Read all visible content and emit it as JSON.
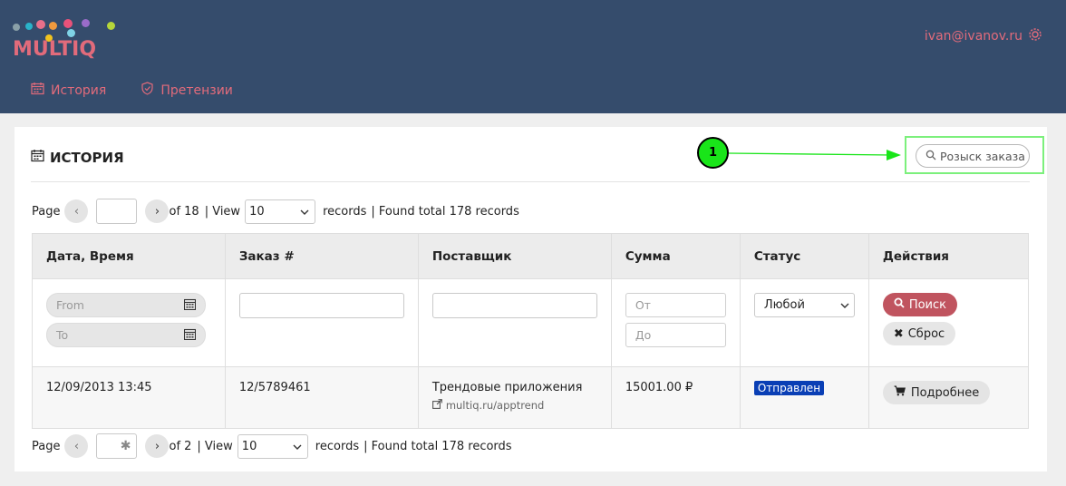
{
  "brand": {
    "logo_text": "MULTIQ"
  },
  "header": {
    "user_email": "ivan@ivanov.ru"
  },
  "nav": {
    "items": [
      {
        "label": "История",
        "icon": "calendar-icon"
      },
      {
        "label": "Претензии",
        "icon": "shield-icon"
      }
    ]
  },
  "page": {
    "title": "ИСТОРИЯ",
    "search_placeholder": "Розыск заказа",
    "annotation_number": "1"
  },
  "pager_top": {
    "page_label": "Page",
    "page_value": "",
    "of_label": "of 18",
    "view_label": "| View",
    "view_value": "10",
    "records_label": "records",
    "found_label": "| Found total 178 records"
  },
  "pager_bottom": {
    "page_label": "Page",
    "page_value": "✱",
    "of_label": "of 2",
    "view_label": "| View",
    "view_value": "10",
    "records_label": "records",
    "found_label": "| Found total 178 records"
  },
  "table": {
    "columns": [
      "Дата, Время",
      "Заказ #",
      "Поставщик",
      "Сумма",
      "Статус",
      "Действия"
    ],
    "filters": {
      "date_from_placeholder": "From",
      "date_to_placeholder": "To",
      "sum_from_placeholder": "От",
      "sum_to_placeholder": "До",
      "status_value": "Любой",
      "search_button": "Поиск",
      "reset_button": "Сброс"
    },
    "rows": [
      {
        "datetime": "12/09/2013 13:45",
        "order": "12/5789461",
        "supplier": "Трендовые приложения",
        "supplier_link": "multiq.ru/apptrend",
        "sum": "15001.00 ₽",
        "status": "Отправлен",
        "action": "Подробнее"
      }
    ]
  },
  "colors": {
    "header_bg": "#354c6c",
    "accent": "#e26b7b",
    "search_button": "#c0545f",
    "status_badge": "#0a3fb5",
    "annotation": "#19e519"
  }
}
